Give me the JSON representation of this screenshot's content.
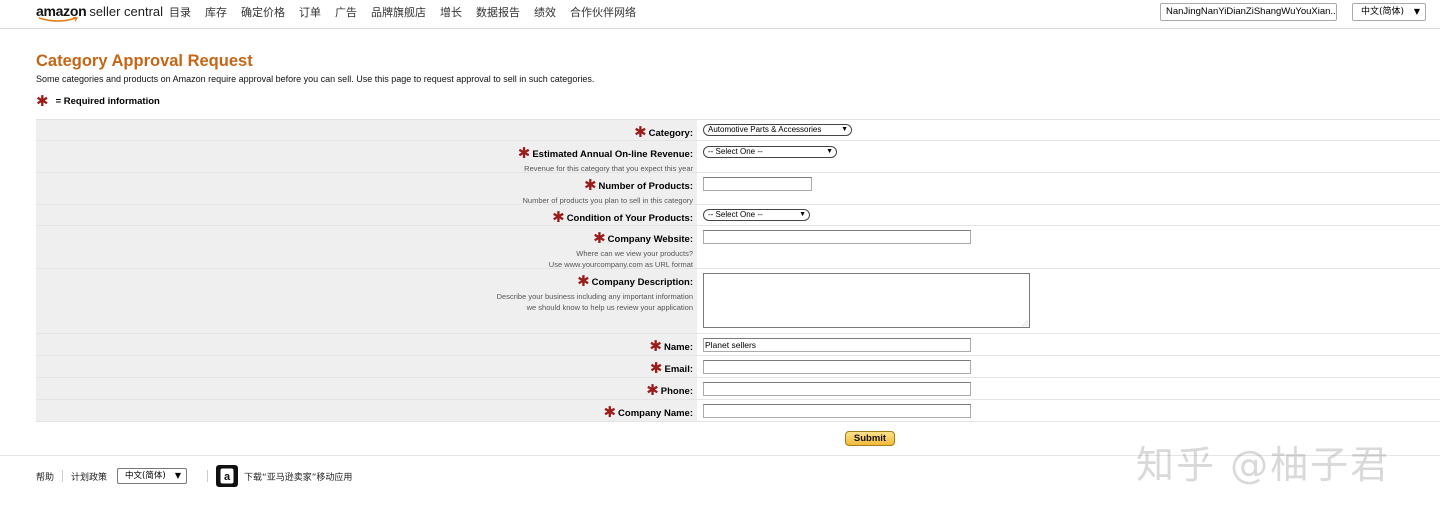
{
  "header": {
    "logo_amazon": "amazon",
    "logo_sc": "seller central",
    "nav": [
      "目录",
      "库存",
      "确定价格",
      "订单",
      "广告",
      "品牌旗舰店",
      "增长",
      "数据报告",
      "绩效",
      "合作伙伴网络"
    ],
    "account": "NanJingNanYiDianZiShangWuYouXian...",
    "language": "中文(简体)"
  },
  "page": {
    "title": "Category Approval Request",
    "description": "Some categories and products on Amazon require approval before you can sell. Use this page to request approval to sell in such categories.",
    "required_star": "✱",
    "required_note": "= Required information"
  },
  "form": {
    "category_label": "Category:",
    "category_value": "Automotive Parts & Accessories",
    "revenue_label": "Estimated Annual On-line Revenue:",
    "revenue_hint": "Revenue for this category that you expect this year",
    "revenue_value": "-- Select One --",
    "products_label": "Number of Products:",
    "products_hint": "Number of products you plan to sell in this category",
    "products_value": "",
    "condition_label": "Condition of Your Products:",
    "condition_value": "-- Select One --",
    "website_label": "Company Website:",
    "website_hint1": "Where can we view your products?",
    "website_hint2": "Use www.yourcompany.com as URL format",
    "website_value": "",
    "desc_label": "Company Description:",
    "desc_hint1": "Describe your business including any important information",
    "desc_hint2": "we should know to help us review your application",
    "name_label": "Name:",
    "name_value": "Planet sellers",
    "email_label": "Email:",
    "email_value": "",
    "phone_label": "Phone:",
    "phone_value": "",
    "company_label": "Company Name:",
    "company_value": "",
    "submit_label": "Submit"
  },
  "footer": {
    "help": "帮助",
    "policies": "计划政策",
    "language": "中文(简体)",
    "app_icon": "a",
    "app_text": "下载“亚马逊卖家”移动应用"
  },
  "watermark": "知乎 @柚子君",
  "icons": {
    "caret": "▼",
    "app": "amazon-app-icon"
  },
  "colors": {
    "title": "#c46615",
    "star": "#9c1c1c",
    "label_bg": "#efefef",
    "submit": "#f2b93a"
  }
}
